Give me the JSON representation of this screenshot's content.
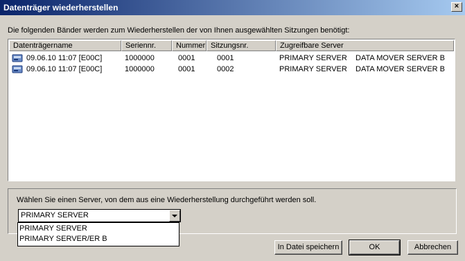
{
  "window": {
    "title": "Datenträger wiederherstellen",
    "close_label": "×"
  },
  "instruction": "Die folgenden Bänder werden zum Wiederherstellen der von Ihnen ausgewählten Sitzungen benötigt:",
  "table": {
    "columns": [
      "Datenträgername",
      "Seriennr.",
      "Nummer",
      "Sitzungsnr.",
      "Zugreifbare Server"
    ],
    "rows": [
      [
        "09.06.10 11:07 [E00C]",
        "1000000",
        "0001",
        "0001",
        "PRIMARY SERVER    DATA MOVER SERVER B"
      ],
      [
        "09.06.10 11:07 [E00C]",
        "1000000",
        "0001",
        "0002",
        "PRIMARY SERVER    DATA MOVER SERVER B"
      ]
    ],
    "row_icon": "tape-drive-icon"
  },
  "server_select": {
    "label": "Wählen Sie einen Server, von dem aus eine Wiederherstellung durchgeführt werden soll.",
    "value": "PRIMARY SERVER",
    "options": [
      "PRIMARY SERVER",
      "PRIMARY SERVER/ER B"
    ]
  },
  "buttons": {
    "save": "In Datei speichern",
    "ok": "OK",
    "cancel": "Abbrechen"
  }
}
